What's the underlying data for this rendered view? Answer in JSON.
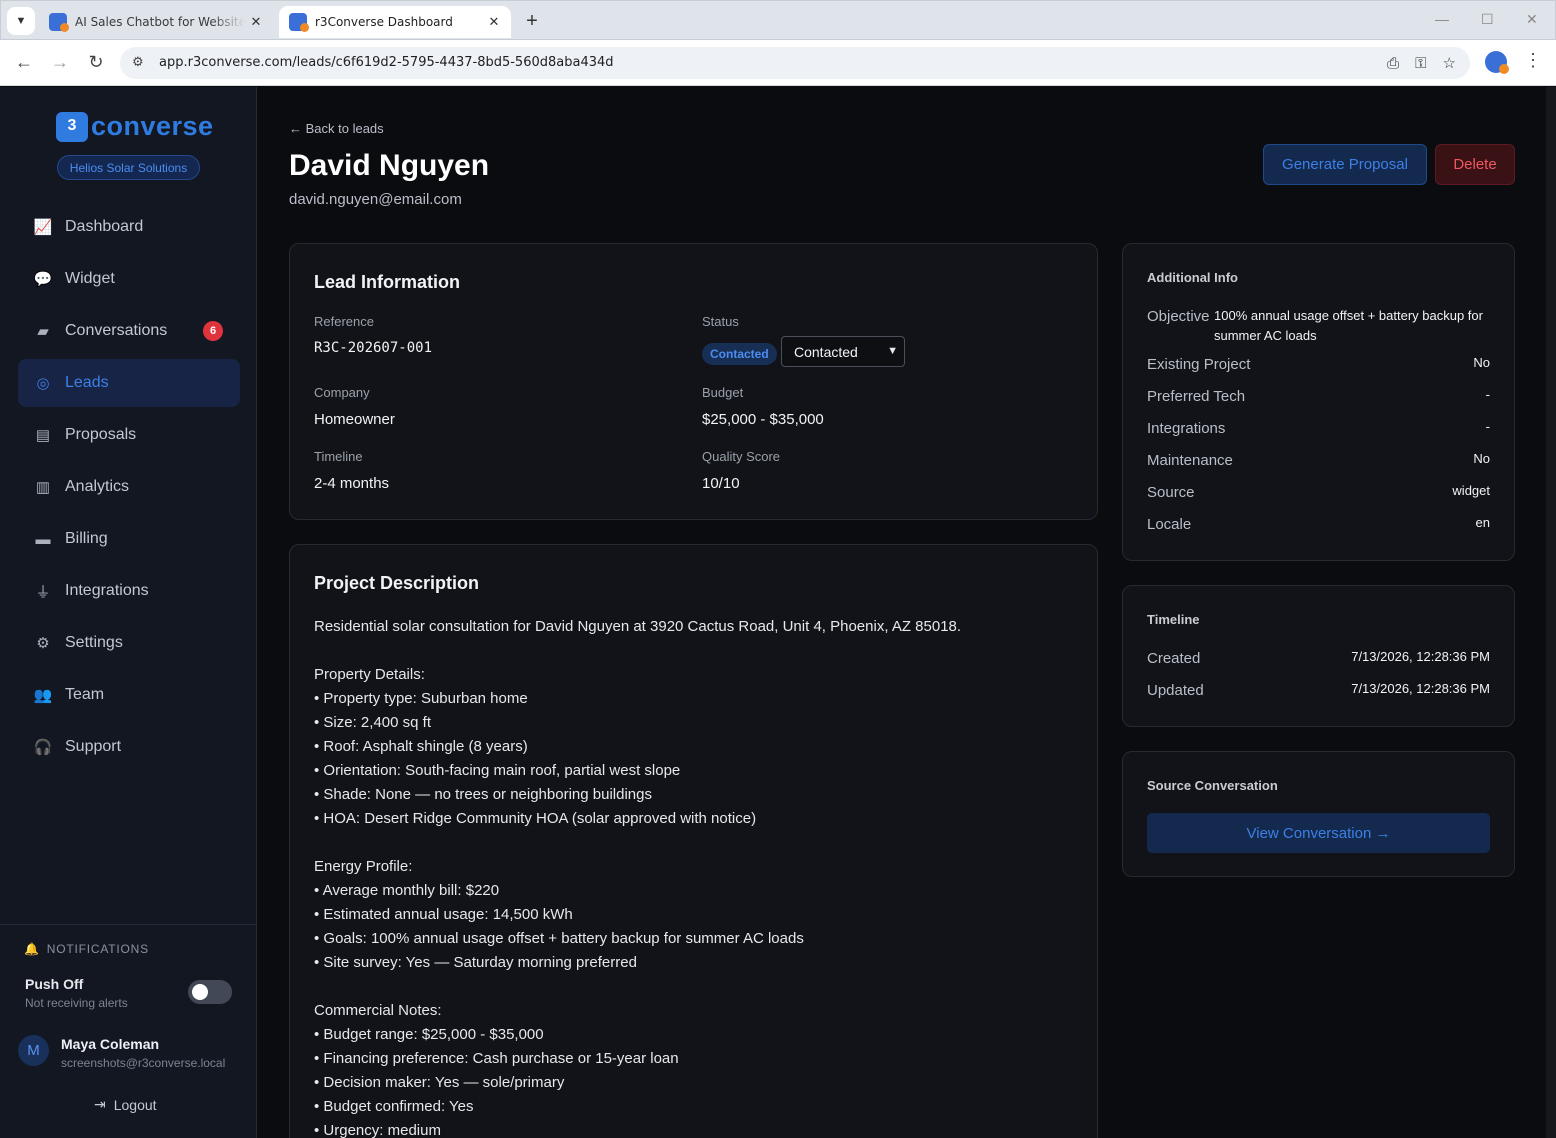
{
  "browser": {
    "tabs": [
      {
        "title": "AI Sales Chatbot for Websites –",
        "active": false
      },
      {
        "title": "r3Converse Dashboard",
        "active": true
      }
    ],
    "url": "app.r3converse.com/leads/c6f619d2-5795-4437-8bd5-560d8aba434d"
  },
  "sidebar": {
    "logo_mark": "3",
    "logo_text": "converse",
    "org": "Helios Solar Solutions",
    "items": [
      {
        "label": "Dashboard",
        "icon": "chart-line-icon"
      },
      {
        "label": "Widget",
        "icon": "chat-bubbles-icon"
      },
      {
        "label": "Conversations",
        "icon": "message-icon",
        "badge": "6"
      },
      {
        "label": "Leads",
        "icon": "target-icon",
        "active": true
      },
      {
        "label": "Proposals",
        "icon": "document-icon"
      },
      {
        "label": "Analytics",
        "icon": "bar-chart-icon"
      },
      {
        "label": "Billing",
        "icon": "credit-card-icon"
      },
      {
        "label": "Integrations",
        "icon": "plug-icon"
      },
      {
        "label": "Settings",
        "icon": "gear-icon"
      },
      {
        "label": "Team",
        "icon": "users-icon"
      },
      {
        "label": "Support",
        "icon": "headset-icon"
      }
    ],
    "notifications": {
      "heading": "NOTIFICATIONS",
      "push_title": "Push Off",
      "push_sub": "Not receiving alerts",
      "enabled": false
    },
    "user": {
      "initial": "M",
      "name": "Maya Coleman",
      "email": "screenshots@r3converse.local"
    },
    "logout": "Logout"
  },
  "header": {
    "back": "← Back to leads",
    "name": "David Nguyen",
    "email": "david.nguyen@email.com",
    "generate_proposal": "Generate Proposal",
    "delete": "Delete"
  },
  "lead_info": {
    "title": "Lead Information",
    "reference_label": "Reference",
    "reference": "R3C-202607-001",
    "status_label": "Status",
    "status_pill": "Contacted",
    "status_select": "Contacted",
    "company_label": "Company",
    "company": "Homeowner",
    "budget_label": "Budget",
    "budget": "$25,000 - $35,000",
    "timeline_label": "Timeline",
    "timeline": "2-4 months",
    "quality_label": "Quality Score",
    "quality": "10/10"
  },
  "project": {
    "title": "Project Description",
    "text": "Residential solar consultation for David Nguyen at 3920 Cactus Road, Unit 4, Phoenix, AZ 85018.\n\nProperty Details:\n• Property type: Suburban home\n• Size: 2,400 sq ft\n• Roof: Asphalt shingle (8 years)\n• Orientation: South-facing main roof, partial west slope\n• Shade: None — no trees or neighboring buildings\n• HOA: Desert Ridge Community HOA (solar approved with notice)\n\nEnergy Profile:\n• Average monthly bill: $220\n• Estimated annual usage: 14,500 kWh\n• Goals: 100% annual usage offset + battery backup for summer AC loads\n• Site survey: Yes — Saturday morning preferred\n\nCommercial Notes:\n• Budget range: $25,000 - $35,000\n• Financing preference: Cash purchase or 15-year loan\n• Decision maker: Yes — sole/primary\n• Budget confirmed: Yes\n• Urgency: medium"
  },
  "additional": {
    "title": "Additional Info",
    "objective_label": "Objective",
    "objective": "100% annual usage offset + battery backup for summer AC loads",
    "rows": [
      {
        "label": "Existing Project",
        "value": "No"
      },
      {
        "label": "Preferred Tech",
        "value": "-"
      },
      {
        "label": "Integrations",
        "value": "-"
      },
      {
        "label": "Maintenance",
        "value": "No"
      },
      {
        "label": "Source",
        "value": "widget"
      },
      {
        "label": "Locale",
        "value": "en"
      }
    ]
  },
  "timeline": {
    "title": "Timeline",
    "created_label": "Created",
    "created": "7/13/2026, 12:28:36 PM",
    "updated_label": "Updated",
    "updated": "7/13/2026, 12:28:36 PM"
  },
  "source": {
    "title": "Source Conversation",
    "button": "View Conversation →"
  },
  "colors": {
    "accent": "#3d7fe6",
    "danger": "#f0585f",
    "badge": "#e0343d",
    "background": "#0b0c10",
    "sidebar": "#131722"
  }
}
